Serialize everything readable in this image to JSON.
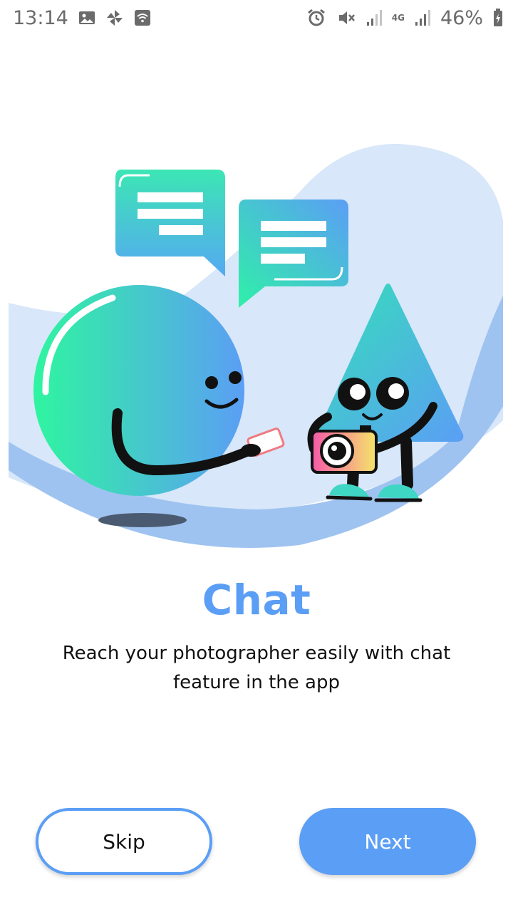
{
  "status_bar": {
    "time": "13:14",
    "network_type": "4G",
    "battery_percent": "46%",
    "icons_left": [
      "image-icon",
      "pinwheel-icon",
      "wifi-box-icon"
    ],
    "icons_right": [
      "alarm-icon",
      "vibrate-mute-icon",
      "signal-icon",
      "signal-icon",
      "battery-charging-icon"
    ]
  },
  "onboarding": {
    "title": "Chat",
    "description": "Reach your photographer easily with chat feature in the app",
    "illustration": "chat-characters-illustration"
  },
  "actions": {
    "skip_label": "Skip",
    "next_label": "Next"
  },
  "colors": {
    "accent": "#5b9ef5",
    "background_blob": "#d8e7f9",
    "background_wave": "#9fc3f0",
    "gradient_green": "#2ff5a0",
    "gradient_blue": "#5b9ef5"
  }
}
